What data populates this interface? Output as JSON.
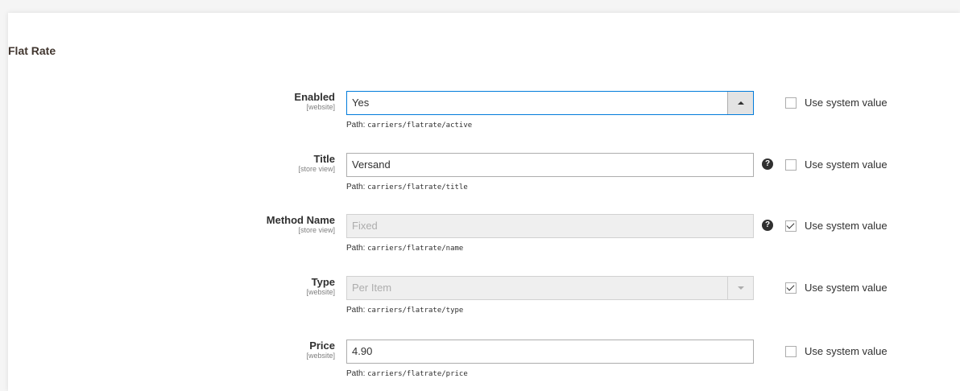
{
  "section": {
    "title": "Flat Rate"
  },
  "system_value_label": "Use system value",
  "path_prefix": "Path:",
  "fields": {
    "enabled": {
      "label": "Enabled",
      "scope": "[website]",
      "value": "Yes",
      "path": "carriers/flatrate/active",
      "use_system": false
    },
    "title": {
      "label": "Title",
      "scope": "[store view]",
      "value": "Versand",
      "path": "carriers/flatrate/title",
      "use_system": false
    },
    "method_name": {
      "label": "Method Name",
      "scope": "[store view]",
      "value": "Fixed",
      "path": "carriers/flatrate/name",
      "use_system": true
    },
    "type": {
      "label": "Type",
      "scope": "[website]",
      "value": "Per Item",
      "path": "carriers/flatrate/type",
      "use_system": true
    },
    "price": {
      "label": "Price",
      "scope": "[website]",
      "value": "4.90",
      "path": "carriers/flatrate/price",
      "use_system": false
    }
  },
  "help_icon_glyph": "?"
}
